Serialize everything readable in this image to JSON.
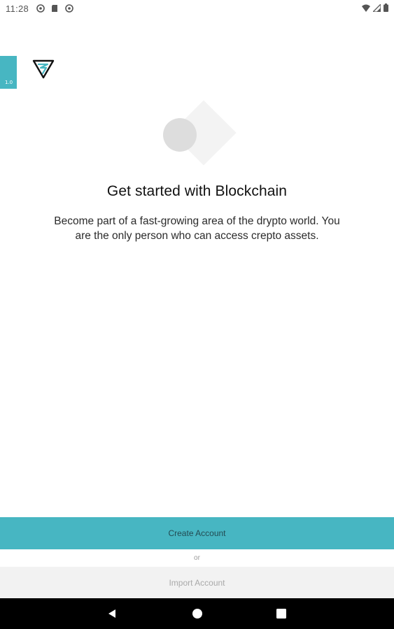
{
  "status_bar": {
    "time": "11:28",
    "left_icons": [
      "sync-icon",
      "sd-card-icon",
      "sync-icon"
    ],
    "right_icons": [
      "wifi-icon",
      "signal-icon",
      "battery-icon"
    ]
  },
  "version_tab": {
    "label": "1.0"
  },
  "brand": {
    "logo_icon": "triangle-s-logo-icon",
    "accent_color": "#47b6c2"
  },
  "onboarding": {
    "title": "Get started with Blockchain",
    "description_line1": "Become part of a fast-growing area of the drypto world. You",
    "description_line2": "are the only person who can access crepto assets."
  },
  "actions": {
    "create_label": "Create Account",
    "or_label": "or",
    "import_label": "Import Account"
  },
  "nav_bar": {
    "buttons": [
      "back-icon",
      "home-icon",
      "recents-icon"
    ]
  }
}
